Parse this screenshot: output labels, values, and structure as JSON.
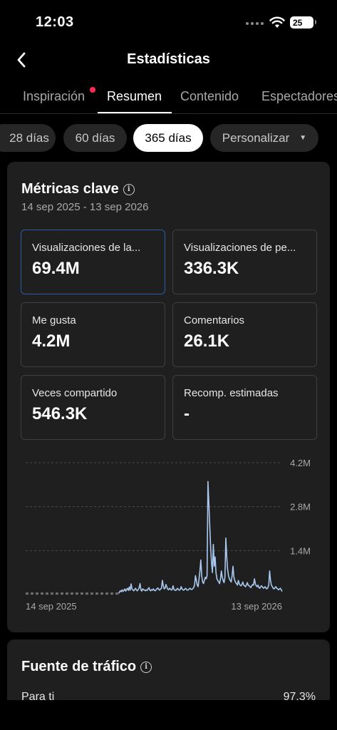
{
  "status": {
    "time": "12:03",
    "battery": "25"
  },
  "header": {
    "title": "Estadísticas"
  },
  "tabs": [
    {
      "label": "Inspiración",
      "has_dot": true
    },
    {
      "label": "Resumen",
      "active": true
    },
    {
      "label": "Contenido"
    },
    {
      "label": "Espectadores"
    }
  ],
  "ranges": [
    {
      "label": "28 días"
    },
    {
      "label": "60 días"
    },
    {
      "label": "365 días",
      "active": true
    },
    {
      "label": "Personalizar"
    }
  ],
  "key_metrics": {
    "title": "Métricas clave",
    "date_range": "14 sep 2025 - 13 sep 2026",
    "cards": [
      {
        "label": "Visualizaciones de la...",
        "value": "69.4M",
        "selected": true
      },
      {
        "label": "Visualizaciones de pe...",
        "value": "336.3K"
      },
      {
        "label": "Me gusta",
        "value": "4.2M"
      },
      {
        "label": "Comentarios",
        "value": "26.1K"
      },
      {
        "label": "Veces compartido",
        "value": "546.3K"
      },
      {
        "label": "Recomp. estimadas",
        "value": "-"
      }
    ]
  },
  "chart_data": {
    "type": "line",
    "x_start": "14 sep 2025",
    "x_end": "13 sep 2026",
    "x_tick_labels": [
      "14 sep 2025",
      "13 sep 2026"
    ],
    "y_tick_labels": [
      "4.2M",
      "2.8M",
      "1.4M"
    ],
    "ylim": [
      0,
      4.2
    ],
    "y_unit": "M",
    "grid": true,
    "series_color": "#a9c9f0",
    "values_millions": [
      0.03,
      0.03,
      0.03,
      0.03,
      0.03,
      0.03,
      0.03,
      0.03,
      0.03,
      0.03,
      0.03,
      0.03,
      0.03,
      0.03,
      0.03,
      0.03,
      0.03,
      0.03,
      0.03,
      0.03,
      0.03,
      0.03,
      0.03,
      0.03,
      0.03,
      0.03,
      0.03,
      0.03,
      0.03,
      0.03,
      0.03,
      0.03,
      0.03,
      0.03,
      0.03,
      0.03,
      0.03,
      0.03,
      0.03,
      0.03,
      0.03,
      0.03,
      0.03,
      0.03,
      0.03,
      0.03,
      0.03,
      0.03,
      0.03,
      0.03,
      0.03,
      0.03,
      0.03,
      0.03,
      0.03,
      0.03,
      0.03,
      0.03,
      0.03,
      0.03,
      0.03,
      0.03,
      0.03,
      0.03,
      0.03,
      0.03,
      0.03,
      0.03,
      0.03,
      0.03,
      0.03,
      0.03,
      0.03,
      0.03,
      0.03,
      0.03,
      0.03,
      0.03,
      0.03,
      0.03,
      0.03,
      0.03,
      0.03,
      0.03,
      0.03,
      0.03,
      0.03,
      0.03,
      0.03,
      0.03,
      0.03,
      0.03,
      0.03,
      0.03,
      0.03,
      0.03,
      0.03,
      0.03,
      0.03,
      0.03,
      0.03,
      0.03,
      0.03,
      0.03,
      0.04,
      0.08,
      0.12,
      0.09,
      0.15,
      0.1,
      0.13,
      0.18,
      0.11,
      0.16,
      0.2,
      0.13,
      0.24,
      0.14,
      0.34,
      0.18,
      0.15,
      0.12,
      0.16,
      0.2,
      0.14,
      0.12,
      0.16,
      0.22,
      0.35,
      0.15,
      0.11,
      0.18,
      0.16,
      0.14,
      0.12,
      0.15,
      0.13,
      0.18,
      0.22,
      0.14,
      0.12,
      0.16,
      0.14,
      0.18,
      0.13,
      0.12,
      0.15,
      0.19,
      0.21,
      0.16,
      0.14,
      0.18,
      0.2,
      0.45,
      0.28,
      0.18,
      0.2,
      0.32,
      0.24,
      0.17,
      0.15,
      0.2,
      0.18,
      0.14,
      0.17,
      0.28,
      0.16,
      0.14,
      0.13,
      0.17,
      0.2,
      0.15,
      0.14,
      0.16,
      0.25,
      0.18,
      0.15,
      0.14,
      0.17,
      0.2,
      0.16,
      0.14,
      0.15,
      0.18,
      0.2,
      0.17,
      0.16,
      0.19,
      0.22,
      0.3,
      0.6,
      0.45,
      0.3,
      0.25,
      0.5,
      0.75,
      1.1,
      0.6,
      0.4,
      0.35,
      0.45,
      0.55,
      0.5,
      0.6,
      3.6,
      2.9,
      2.2,
      1.5,
      1.0,
      0.7,
      1.6,
      0.9,
      1.2,
      0.7,
      0.5,
      0.45,
      0.4,
      0.35,
      0.5,
      0.75,
      0.55,
      0.45,
      0.38,
      0.55,
      1.8,
      1.2,
      0.8,
      0.6,
      0.5,
      0.45,
      0.4,
      0.6,
      0.9,
      0.55,
      0.45,
      0.38,
      0.35,
      0.3,
      0.45,
      0.35,
      0.3,
      0.28,
      0.32,
      0.4,
      0.3,
      0.28,
      0.25,
      0.3,
      0.38,
      0.3,
      0.28,
      0.25,
      0.22,
      0.28,
      0.32,
      0.3,
      0.5,
      0.35,
      0.28,
      0.25,
      0.3,
      0.22,
      0.2,
      0.25,
      0.28,
      0.24,
      0.2,
      0.22,
      0.25,
      0.2,
      0.18,
      0.22,
      0.3,
      0.75,
      0.45,
      0.3,
      0.25,
      0.2,
      0.18,
      0.22,
      0.25,
      0.2,
      0.18,
      0.15,
      0.18,
      0.2,
      0.15,
      0.1
    ]
  },
  "traffic": {
    "title": "Fuente de tráfico",
    "rows": [
      {
        "label": "Para ti",
        "percent": "97.3%"
      }
    ]
  }
}
